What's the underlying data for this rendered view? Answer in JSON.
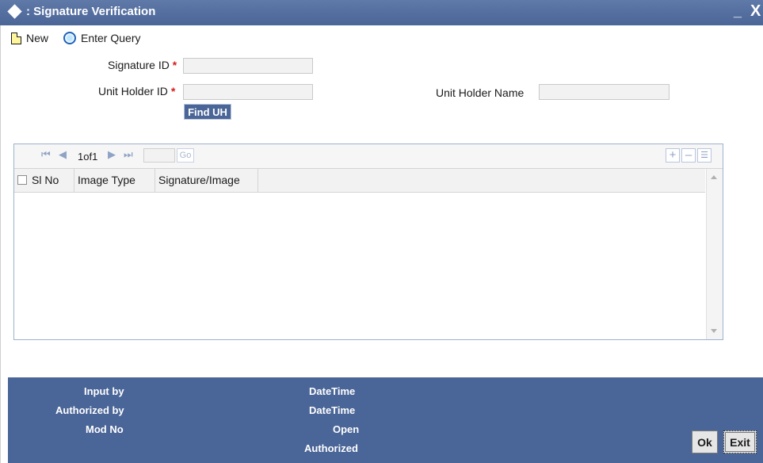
{
  "window": {
    "title": ": Signature Verification",
    "minimize_label": "_",
    "close_label": "X"
  },
  "toolbar": {
    "new_label": "New",
    "enter_query_label": "Enter Query"
  },
  "form": {
    "signature_id_label": "Signature ID",
    "signature_id_value": "",
    "unit_holder_id_label": "Unit Holder ID",
    "unit_holder_id_value": "",
    "unit_holder_name_label": "Unit Holder Name",
    "unit_holder_name_value": "",
    "required_marker": "*",
    "find_uh_label": "Find UH"
  },
  "grid": {
    "pager": {
      "current_page": "1",
      "of_label": "of",
      "total_pages": "1",
      "page_input": "",
      "go_label": "Go"
    },
    "columns": [
      "Sl No",
      "Image Type",
      "Signature/Image"
    ],
    "rows": []
  },
  "footer": {
    "input_by_label": "Input by",
    "authorized_by_label": "Authorized by",
    "mod_no_label": "Mod No",
    "datetime_label_1": "DateTime",
    "datetime_label_2": "DateTime",
    "open_label": "Open",
    "authorized_label": "Authorized",
    "ok_label": "Ok",
    "exit_label": "Exit"
  },
  "colors": {
    "titlebar": "#4a6597",
    "footer": "#4a6597",
    "required": "#d81b1b",
    "input_bg": "#f2f2f2"
  }
}
